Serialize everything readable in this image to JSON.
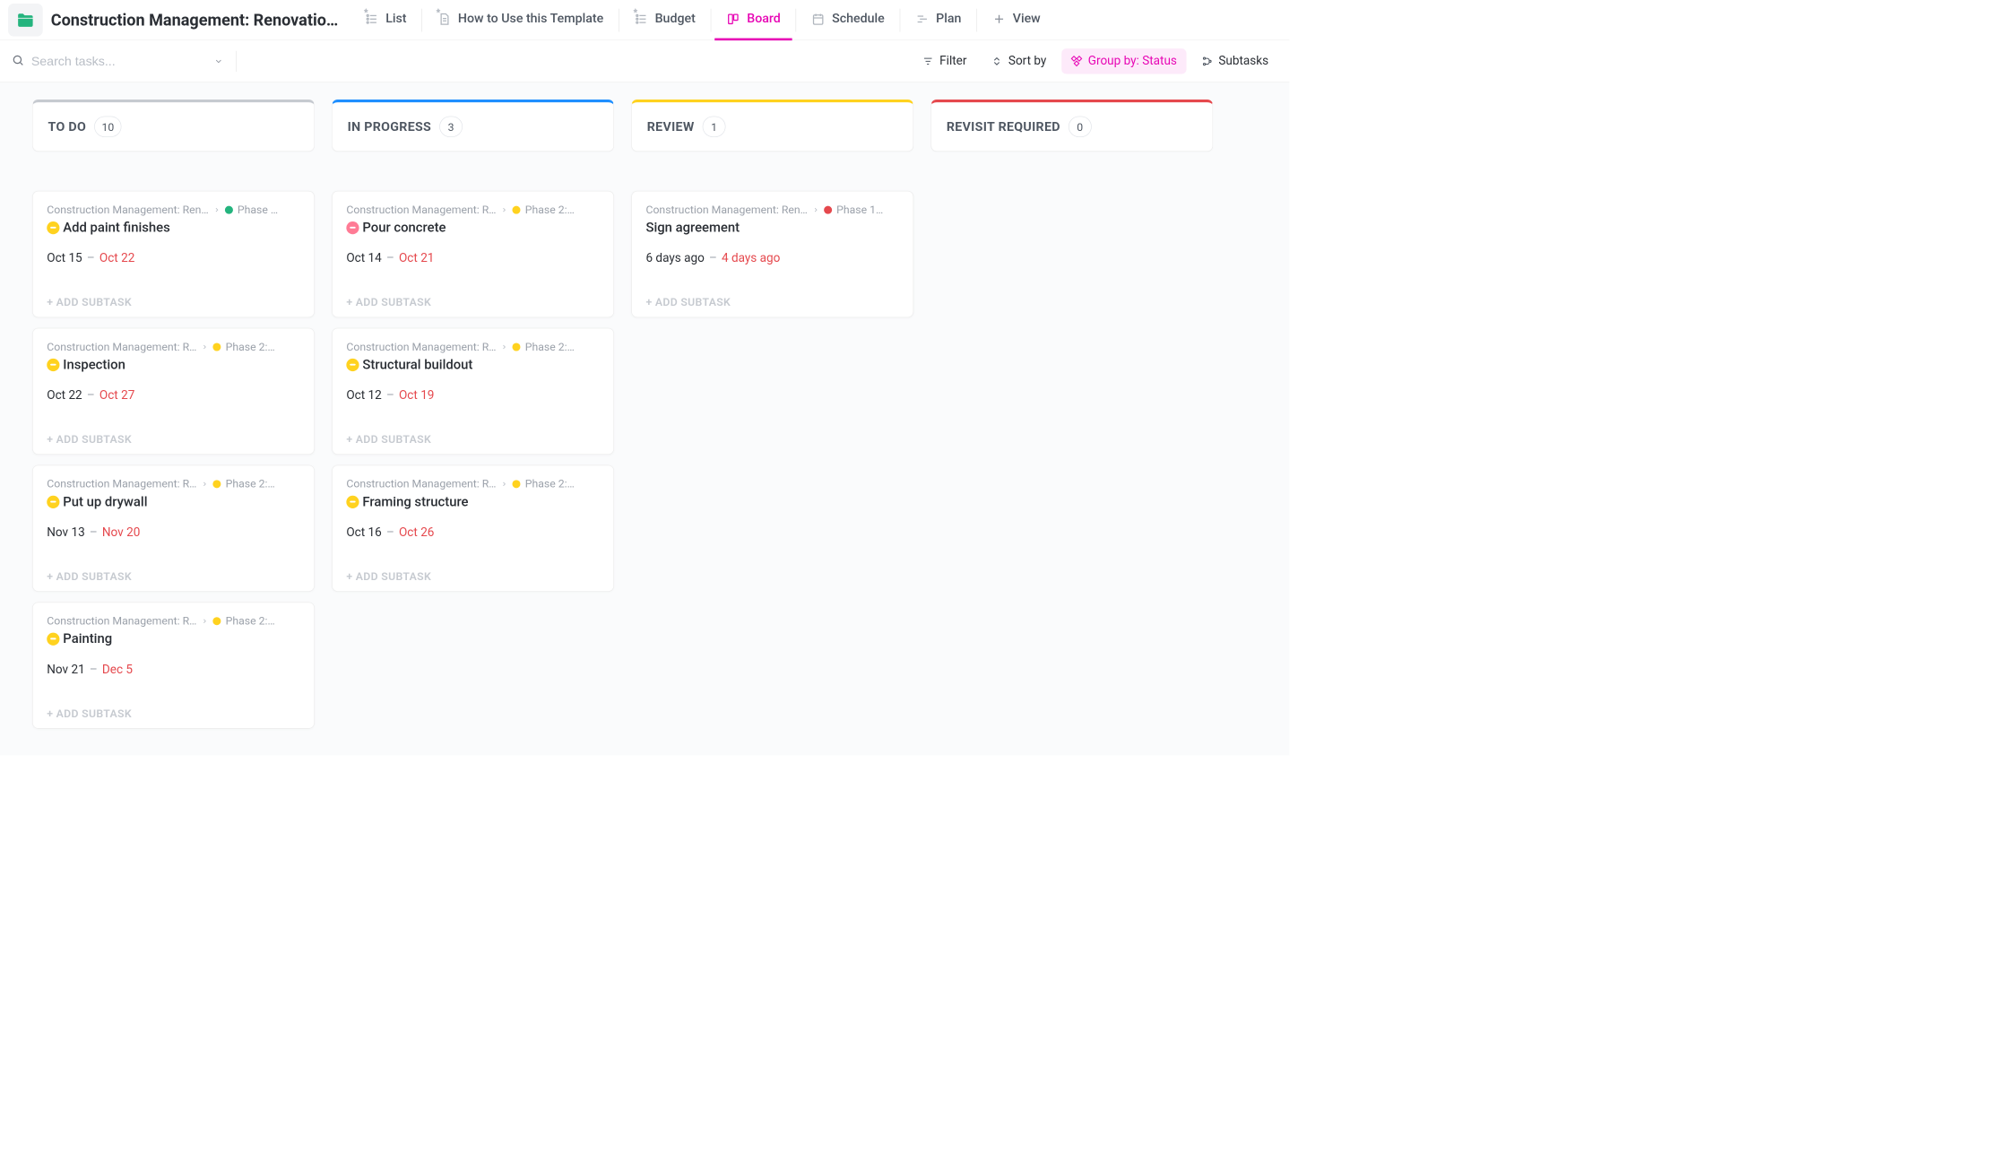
{
  "header": {
    "title": "Construction Management: Renovatio…",
    "tabs": [
      {
        "label": "List",
        "pinned": true,
        "icon": "list",
        "active": false
      },
      {
        "label": "How to Use this Template",
        "pinned": true,
        "icon": "doc",
        "active": false
      },
      {
        "label": "Budget",
        "pinned": true,
        "icon": "list",
        "active": false
      },
      {
        "label": "Board",
        "pinned": false,
        "icon": "board",
        "active": true
      },
      {
        "label": "Schedule",
        "pinned": false,
        "icon": "calendar",
        "active": false
      },
      {
        "label": "Plan",
        "pinned": false,
        "icon": "gantt",
        "active": false
      },
      {
        "label": "View",
        "pinned": false,
        "icon": "plus",
        "active": false
      }
    ]
  },
  "toolbar": {
    "search_placeholder": "Search tasks...",
    "filter": "Filter",
    "sort": "Sort by",
    "group_prefix": "Group by: ",
    "group_value": "Status",
    "subtasks": "Subtasks"
  },
  "board": {
    "add_subtask": "+ ADD SUBTASK",
    "columns": [
      {
        "id": "todo",
        "name": "TO DO",
        "count": 10,
        "class": "col-todo",
        "cards": [
          {
            "project": "Construction Management: Ren…",
            "project_class": "long",
            "phase": "Phase …",
            "phase_color": "dot-green",
            "priority": "yellow",
            "title": "Add paint finishes",
            "start": "Oct 15",
            "end": "Oct 22"
          },
          {
            "project": "Construction Management: R…",
            "phase": "Phase 2:…",
            "phase_color": "dot-yellow",
            "priority": "yellow",
            "title": "Inspection",
            "start": "Oct 22",
            "end": "Oct 27"
          },
          {
            "project": "Construction Management: R…",
            "phase": "Phase 2:…",
            "phase_color": "dot-yellow",
            "priority": "yellow",
            "title": "Put up drywall",
            "start": "Nov 13",
            "end": "Nov 20"
          },
          {
            "project": "Construction Management: R…",
            "phase": "Phase 2:…",
            "phase_color": "dot-yellow",
            "priority": "yellow",
            "title": "Painting",
            "start": "Nov 21",
            "end": "Dec 5"
          }
        ]
      },
      {
        "id": "prog",
        "name": "IN PROGRESS",
        "count": 3,
        "class": "col-prog",
        "cards": [
          {
            "project": "Construction Management: R…",
            "phase": "Phase 2:…",
            "phase_color": "dot-yellow",
            "priority": "pink",
            "title": "Pour concrete",
            "start": "Oct 14",
            "end": "Oct 21"
          },
          {
            "project": "Construction Management: R…",
            "phase": "Phase 2:…",
            "phase_color": "dot-yellow",
            "priority": "yellow",
            "title": "Structural buildout",
            "start": "Oct 12",
            "end": "Oct 19"
          },
          {
            "project": "Construction Management: R…",
            "phase": "Phase 2:…",
            "phase_color": "dot-yellow",
            "priority": "yellow",
            "title": "Framing structure",
            "start": "Oct 16",
            "end": "Oct 26"
          }
        ]
      },
      {
        "id": "review",
        "name": "REVIEW",
        "count": 1,
        "class": "col-review",
        "cards": [
          {
            "project": "Construction Management: Ren…",
            "project_class": "long",
            "phase": "Phase 1…",
            "phase_color": "dot-red",
            "priority": "",
            "title": "Sign agreement",
            "start": "6 days ago",
            "end": "4 days ago"
          }
        ]
      },
      {
        "id": "revisit",
        "name": "REVISIT REQUIRED",
        "count": 0,
        "class": "col-revisit",
        "cards": []
      }
    ]
  }
}
